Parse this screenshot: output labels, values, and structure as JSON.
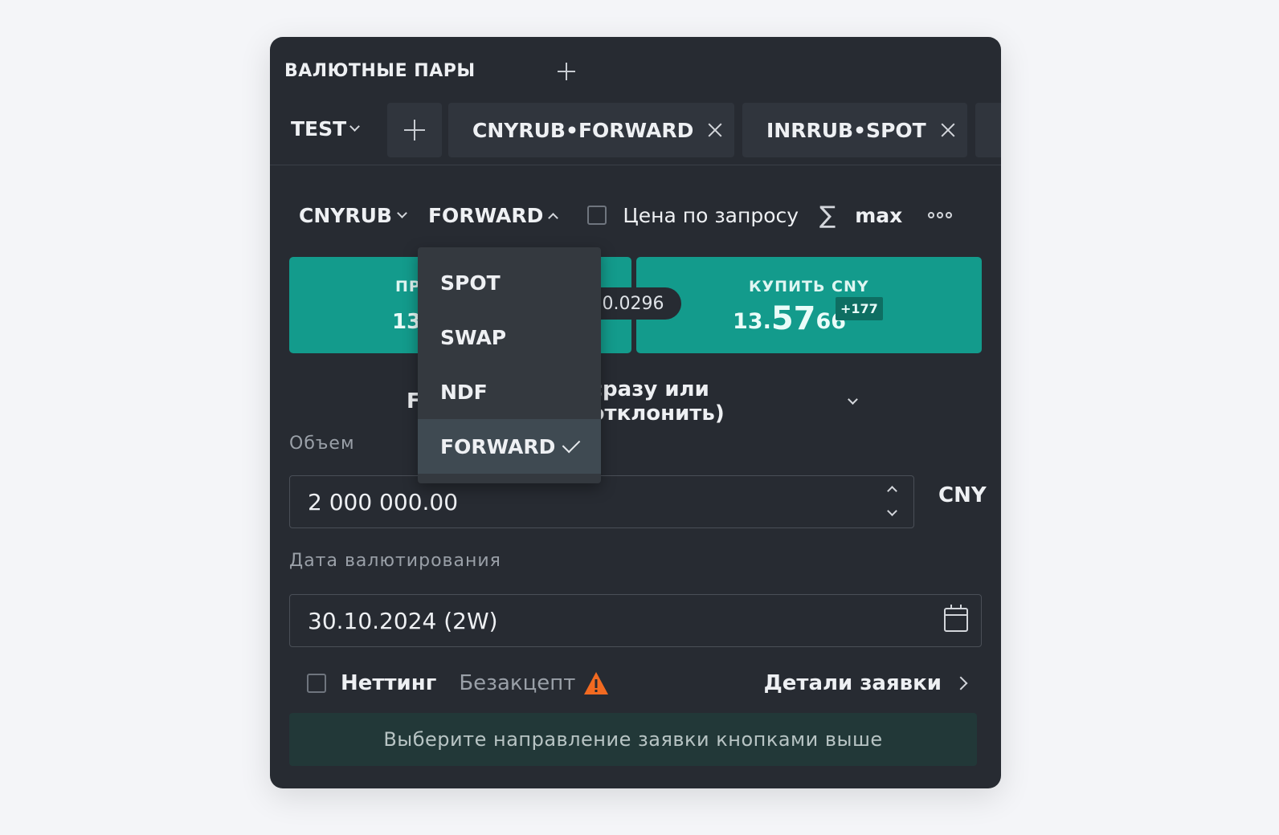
{
  "panel": {
    "title": "ВАЛЮТНЫЕ ПАРЫ"
  },
  "tabs": {
    "group": "TEST",
    "items": [
      {
        "label": "CNYRUB•FORWARD"
      },
      {
        "label": "INRRUB•SPOT"
      }
    ]
  },
  "toolbar": {
    "pair": "CNYRUB",
    "instrument": "FORWARD",
    "rfq_label": "Цена по запросу",
    "sigma": "∑",
    "max_label": "max"
  },
  "quote": {
    "sell_label": "ПР",
    "sell_price": "13",
    "spread": "0.0296",
    "buy_label": "КУПИТЬ CNY",
    "buy_price_prefix": "13.",
    "buy_price_big": "57",
    "buy_price_tail": "66",
    "buy_delta": "+177"
  },
  "execution": {
    "mode_prefix": "F",
    "mode_text": "сразу или отклонить)"
  },
  "volume": {
    "label": "Объем",
    "value": "2 000 000.00",
    "currency": "CNY"
  },
  "value_date": {
    "label": "Дата валютирования",
    "value": "30.10.2024 (2W)"
  },
  "options": {
    "netting_label": "Неттинг",
    "noaccept_label": "Безакцепт",
    "details_label": "Детали заявки"
  },
  "hint": "Выберите направление заявки кнопками выше",
  "dropdown": {
    "items": [
      {
        "label": "SPOT"
      },
      {
        "label": "SWAP"
      },
      {
        "label": "NDF"
      },
      {
        "label": "FORWARD",
        "selected": true
      }
    ]
  },
  "colors": {
    "accent": "#139b8c",
    "panel_bg": "#272b32",
    "warning": "#f26a21"
  }
}
